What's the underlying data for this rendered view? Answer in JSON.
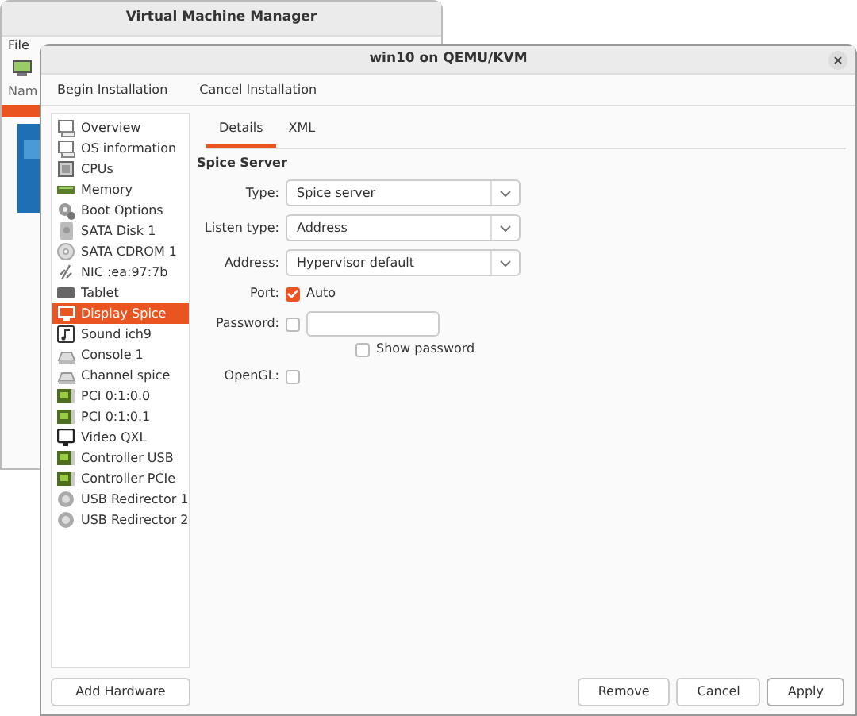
{
  "background_window": {
    "title": "Virtual Machine Manager",
    "menu": [
      "File"
    ],
    "column_header": "Nam"
  },
  "dialog": {
    "title": "win10 on QEMU/KVM",
    "toolbar": [
      "Begin Installation",
      "Cancel Installation"
    ],
    "hardware": [
      {
        "label": "Overview",
        "kind": "monitor",
        "selected": false
      },
      {
        "label": "OS information",
        "kind": "monitor",
        "selected": false
      },
      {
        "label": "CPUs",
        "kind": "cpu",
        "selected": false
      },
      {
        "label": "Memory",
        "kind": "memory",
        "selected": false
      },
      {
        "label": "Boot Options",
        "kind": "gear",
        "selected": false
      },
      {
        "label": "SATA Disk 1",
        "kind": "disk",
        "selected": false
      },
      {
        "label": "SATA CDROM 1",
        "kind": "cdrom",
        "selected": false
      },
      {
        "label": "NIC :ea:97:7b",
        "kind": "nic",
        "selected": false
      },
      {
        "label": "Tablet",
        "kind": "tablet",
        "selected": false
      },
      {
        "label": "Display Spice",
        "kind": "display",
        "selected": true
      },
      {
        "label": "Sound ich9",
        "kind": "sound",
        "selected": false
      },
      {
        "label": "Console 1",
        "kind": "console",
        "selected": false
      },
      {
        "label": "Channel spice",
        "kind": "console",
        "selected": false
      },
      {
        "label": "PCI 0:1:0.0",
        "kind": "pci",
        "selected": false
      },
      {
        "label": "PCI 0:1:0.1",
        "kind": "pci",
        "selected": false
      },
      {
        "label": "Video QXL",
        "kind": "video",
        "selected": false
      },
      {
        "label": "Controller USB",
        "kind": "pci",
        "selected": false
      },
      {
        "label": "Controller PCIe",
        "kind": "pci",
        "selected": false
      },
      {
        "label": "USB Redirector 1",
        "kind": "usb",
        "selected": false
      },
      {
        "label": "USB Redirector 2",
        "kind": "usb",
        "selected": false
      }
    ],
    "add_button": "Add Hardware",
    "tabs": [
      {
        "label": "Details",
        "selected": true
      },
      {
        "label": "XML",
        "selected": false
      }
    ],
    "section": "Spice Server",
    "fields": [
      {
        "kind": "select",
        "label": "Type:",
        "value": "Spice server"
      },
      {
        "kind": "select",
        "label": "Listen type:",
        "value": "Address"
      },
      {
        "kind": "select",
        "label": "Address:",
        "value": "Hypervisor default"
      },
      {
        "kind": "checkbox",
        "label": "Port:",
        "text": "Auto",
        "checked": true
      },
      {
        "kind": "password",
        "label": "Password:",
        "checked": false,
        "show_label": "Show password",
        "show_checked": false
      },
      {
        "kind": "checkbox",
        "label": "OpenGL:",
        "checked": false
      }
    ],
    "buttons": [
      {
        "label": "Remove",
        "kind": "plain"
      },
      {
        "label": "Cancel",
        "kind": "plain"
      },
      {
        "label": "Apply",
        "kind": "default"
      }
    ]
  }
}
